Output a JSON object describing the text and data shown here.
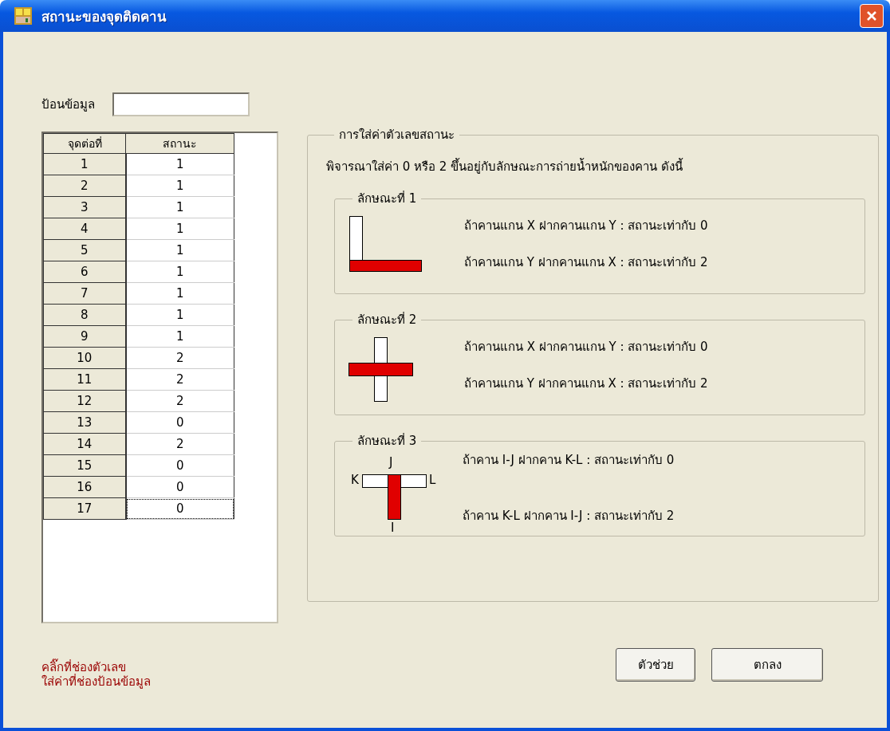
{
  "window": {
    "title": "สถานะของจุดติดคาน"
  },
  "entry": {
    "label": "ป้อนข้อมูล"
  },
  "table": {
    "columns": [
      "จุดต่อที่",
      "สถานะ"
    ],
    "rows": [
      {
        "point": "1",
        "status": "1",
        "selected": false
      },
      {
        "point": "2",
        "status": "1",
        "selected": false
      },
      {
        "point": "3",
        "status": "1",
        "selected": false
      },
      {
        "point": "4",
        "status": "1",
        "selected": false
      },
      {
        "point": "5",
        "status": "1",
        "selected": false
      },
      {
        "point": "6",
        "status": "1",
        "selected": false
      },
      {
        "point": "7",
        "status": "1",
        "selected": false
      },
      {
        "point": "8",
        "status": "1",
        "selected": false
      },
      {
        "point": "9",
        "status": "1",
        "selected": false
      },
      {
        "point": "10",
        "status": "2",
        "selected": false
      },
      {
        "point": "11",
        "status": "2",
        "selected": false
      },
      {
        "point": "12",
        "status": "2",
        "selected": false
      },
      {
        "point": "13",
        "status": "0",
        "selected": false
      },
      {
        "point": "14",
        "status": "2",
        "selected": false
      },
      {
        "point": "15",
        "status": "0",
        "selected": false
      },
      {
        "point": "16",
        "status": "0",
        "selected": false
      },
      {
        "point": "17",
        "status": "0",
        "selected": true
      }
    ]
  },
  "guide": {
    "title": "การใส่ค่าตัวเลขสถานะ",
    "intro": "พิจารณาใส่ค่า 0 หรือ 2 ขึ้นอยู่กับลักษณะการถ่ายน้ำหนักของคาน ดังนี้",
    "cases": [
      {
        "title": "ลักษณะที่ 1",
        "kind": "L",
        "lines": [
          "ถ้าคานแกน X ฝากคานแกน Y : สถานะเท่ากับ 0",
          "ถ้าคานแกน Y ฝากคานแกน X : สถานะเท่ากับ 2"
        ]
      },
      {
        "title": "ลักษณะที่ 2",
        "kind": "cross",
        "lines": [
          "ถ้าคานแกน X ฝากคานแกน Y : สถานะเท่ากับ 0",
          "ถ้าคานแกน Y ฝากคานแกน X : สถานะเท่ากับ 2"
        ]
      },
      {
        "title": "ลักษณะที่ 3",
        "kind": "T",
        "labels": [
          "J",
          "K",
          "L",
          "I"
        ],
        "lines": [
          "ถ้าคาน I-J ฝากคาน K-L : สถานะเท่ากับ 0",
          "ถ้าคาน K-L ฝากคาน I-J : สถานะเท่ากับ 2"
        ]
      }
    ]
  },
  "note": [
    "คลิ๊กที่ช่องตัวเลข",
    "ใส่ค่าที่ช่องป้อนข้อมูล"
  ],
  "buttons": [
    "ตัวช่วย",
    "ตกลง"
  ]
}
